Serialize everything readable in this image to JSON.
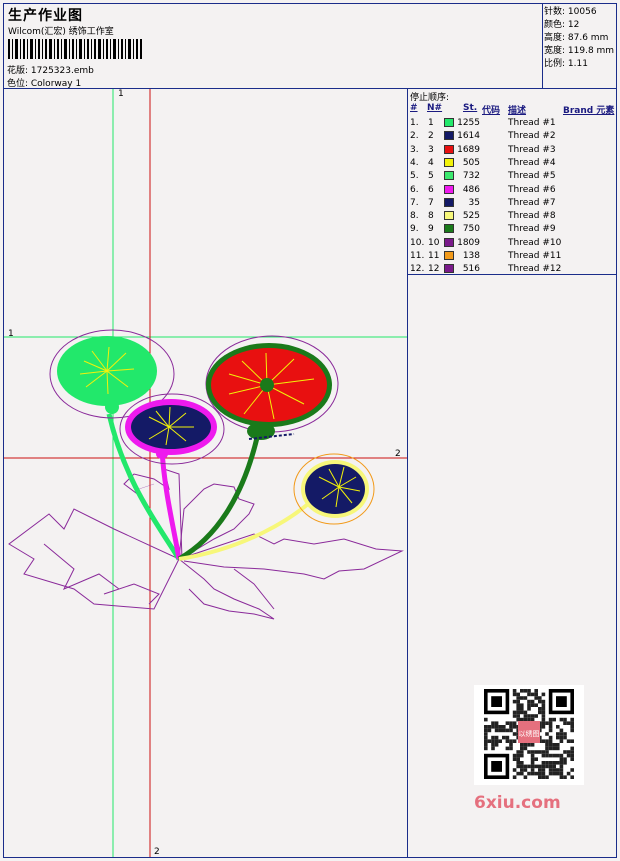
{
  "header": {
    "title": "生产作业图",
    "company": "Wilcom(汇宏) 绣饰工作室",
    "design_label": "花版: 1725323.emb",
    "colorway_label": "色位: Colorway 1"
  },
  "specs": [
    {
      "label": "针数",
      "value": ": 10056"
    },
    {
      "label": "颜色",
      "value": ": 12"
    },
    {
      "label": "高度",
      "value": ": 87.6 mm"
    },
    {
      "label": "宽度",
      "value": ": 119.8 mm"
    },
    {
      "label": "比例",
      "value": ": 1.11"
    }
  ],
  "stop_sequence": {
    "title": "停止顺序:",
    "headers": {
      "hash": "#",
      "no": "N#",
      "st": "St.",
      "code": "代码",
      "desc": "描述",
      "brand": "Brand 元素"
    },
    "rows": [
      {
        "idx": "1.",
        "n": "1",
        "color": "#22e86b",
        "st": "1255",
        "desc": "Thread #1"
      },
      {
        "idx": "2.",
        "n": "2",
        "color": "#141a66",
        "st": "1614",
        "desc": "Thread #2"
      },
      {
        "idx": "3.",
        "n": "3",
        "color": "#e81010",
        "st": "1689",
        "desc": "Thread #3"
      },
      {
        "idx": "4.",
        "n": "4",
        "color": "#f2f20a",
        "st": "505",
        "desc": "Thread #4"
      },
      {
        "idx": "5.",
        "n": "5",
        "color": "#3ce86e",
        "st": "732",
        "desc": "Thread #5"
      },
      {
        "idx": "6.",
        "n": "6",
        "color": "#ee1aee",
        "st": "486",
        "desc": "Thread #6"
      },
      {
        "idx": "7.",
        "n": "7",
        "color": "#141a66",
        "st": "35",
        "desc": "Thread #7"
      },
      {
        "idx": "8.",
        "n": "8",
        "color": "#f7f77a",
        "st": "525",
        "desc": "Thread #8"
      },
      {
        "idx": "9.",
        "n": "9",
        "color": "#1a7a1a",
        "st": "750",
        "desc": "Thread #9"
      },
      {
        "idx": "10.",
        "n": "10",
        "color": "#7a1a8a",
        "st": "1809",
        "desc": "Thread #10"
      },
      {
        "idx": "11.",
        "n": "11",
        "color": "#f29a1a",
        "st": "138",
        "desc": "Thread #11"
      },
      {
        "idx": "12.",
        "n": "12",
        "color": "#7a1a8a",
        "st": "516",
        "desc": "Thread #12"
      }
    ]
  },
  "crosshair_labels": {
    "v1": "1",
    "h1": "1",
    "h2": "2",
    "v2": "2"
  },
  "watermark": {
    "text": "6xiu.com",
    "qr_badge": "以绣图"
  }
}
